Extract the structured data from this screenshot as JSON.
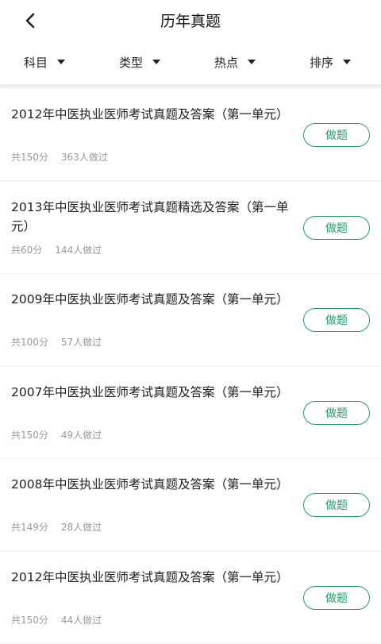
{
  "header": {
    "title": "历年真题",
    "back_icon": "chevron-left-icon"
  },
  "filters": [
    {
      "label": "科目",
      "icon": "caret-down-icon"
    },
    {
      "label": "类型",
      "icon": "caret-down-icon"
    },
    {
      "label": "热点",
      "icon": "caret-down-icon"
    },
    {
      "label": "排序",
      "icon": "caret-down-icon"
    }
  ],
  "items": [
    {
      "title": "2012年中医执业医师考试真题及答案（第一单元）",
      "score": "共150分",
      "count": "363人做过",
      "button": "做题"
    },
    {
      "title": "2013年中医执业医师考试真题精选及答案（第一单元）",
      "score": "共60分",
      "count": "144人做过",
      "button": "做题"
    },
    {
      "title": "2009年中医执业医师考试真题及答案（第一单元）",
      "score": "共100分",
      "count": "57人做过",
      "button": "做题"
    },
    {
      "title": "2007年中医执业医师考试真题及答案（第一单元）",
      "score": "共150分",
      "count": "49人做过",
      "button": "做题"
    },
    {
      "title": "2008年中医执业医师考试真题及答案（第一单元）",
      "score": "共149分",
      "count": "28人做过",
      "button": "做题"
    },
    {
      "title": "2012年中医执业医师考试真题及答案（第一单元）",
      "score": "共150分",
      "count": "44人做过",
      "button": "做题"
    }
  ],
  "colors": {
    "accent": "#2a9b6a",
    "meta_text": "#9a9a9a",
    "background": "#f5f5f5"
  }
}
